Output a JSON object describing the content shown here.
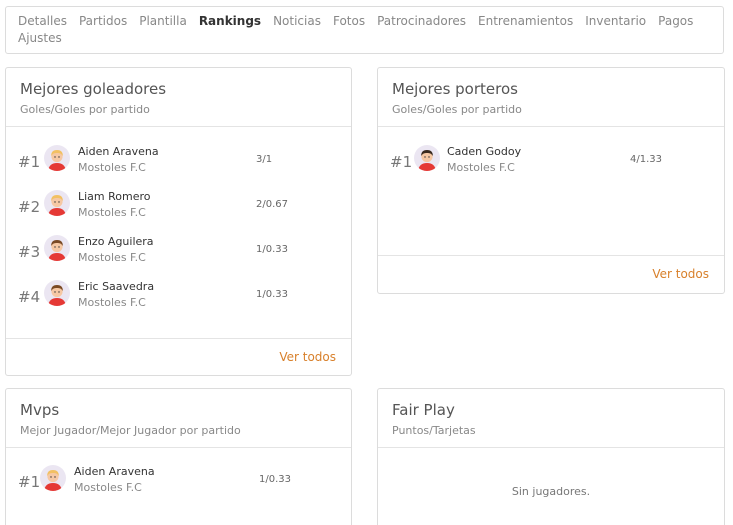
{
  "nav": {
    "tabs": [
      "Detalles",
      "Partidos",
      "Plantilla",
      "Rankings",
      "Noticias",
      "Fotos",
      "Patrocinadores",
      "Entrenamientos",
      "Inventario",
      "Pagos",
      "Ajustes"
    ],
    "active": "Rankings"
  },
  "goleadores": {
    "title": "Mejores goleadores",
    "subtitle": "Goles/Goles por partido",
    "rows": [
      {
        "rank": "#1",
        "name": "Aiden Aravena",
        "team": "Mostoles F.C",
        "stat": "3/1",
        "hair": "#f2c063"
      },
      {
        "rank": "#2",
        "name": "Liam Romero",
        "team": "Mostoles F.C",
        "stat": "2/0.67",
        "hair": "#f2c063"
      },
      {
        "rank": "#3",
        "name": "Enzo Aguilera",
        "team": "Mostoles F.C",
        "stat": "1/0.33",
        "hair": "#7a4a25"
      },
      {
        "rank": "#4",
        "name": "Eric Saavedra",
        "team": "Mostoles F.C",
        "stat": "1/0.33",
        "hair": "#7a4a25"
      }
    ],
    "footer": "Ver todos"
  },
  "porteros": {
    "title": "Mejores porteros",
    "subtitle": "Goles/Goles por partido",
    "rows": [
      {
        "rank": "#1",
        "name": "Caden Godoy",
        "team": "Mostoles F.C",
        "stat": "4/1.33",
        "hair": "#3a2a1e"
      }
    ],
    "footer": "Ver todos"
  },
  "mvps": {
    "title": "Mvps",
    "subtitle": "Mejor Jugador/Mejor Jugador por partido",
    "rows": [
      {
        "rank": "#1",
        "name": "Aiden Aravena",
        "team": "Mostoles F.C",
        "stat": "1/0.33",
        "hair": "#f2c063"
      }
    ]
  },
  "fairplay": {
    "title": "Fair Play",
    "subtitle": "Puntos/Tarjetas",
    "empty": "Sin jugadores."
  },
  "colors": {
    "accent": "#d8802b",
    "border": "#dcdcdc",
    "shirt": "#e53935",
    "avatar_bg": "#ebe6f2"
  }
}
